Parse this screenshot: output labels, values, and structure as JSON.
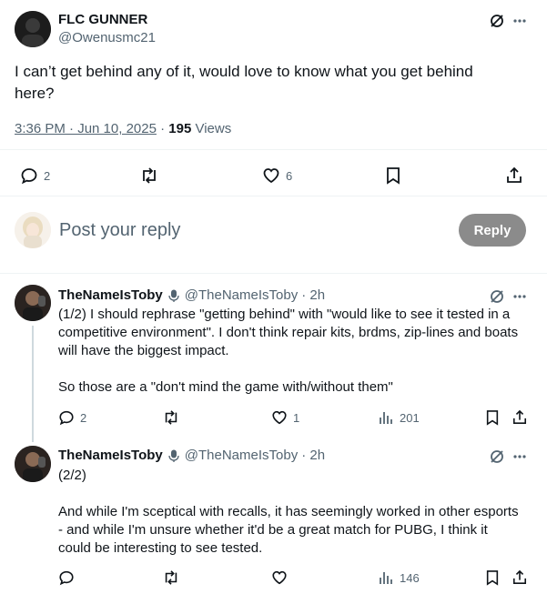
{
  "main_post": {
    "display_name": "FLC GUNNER",
    "handle": "@Owenusmc21",
    "text": "I can’t get behind any of it, would love to know what you get behind here?",
    "time": "3:36 PM · Jun 10, 2025",
    "separator": " · ",
    "views_count": "195",
    "views_label": " Views",
    "actions": {
      "reply_count": "2",
      "repost_count": "",
      "like_count": "6"
    }
  },
  "composer": {
    "placeholder": "Post your reply",
    "reply_button": "Reply"
  },
  "replies": [
    {
      "display_name": "TheNameIsToby",
      "handle": "@TheNameIsToby",
      "time": "· 2h",
      "paragraphs": [
        "(1/2) I should rephrase \"getting behind\" with \"would like to see it tested in a competitive environment\". I don't think repair kits, brdms, zip-lines and boats will have the biggest impact.",
        "So those are a \"don't mind the game with/without them\""
      ],
      "reply_count": "2",
      "repost_count": "",
      "like_count": "1",
      "views_count": "201"
    },
    {
      "display_name": "TheNameIsToby",
      "handle": "@TheNameIsToby",
      "time": "· 2h",
      "paragraphs": [
        "(2/2)",
        "And while I'm sceptical with recalls, it has seemingly worked in other esports - and while I'm unsure whether it'd be a great match for PUBG, I think it could be interesting to see tested."
      ],
      "reply_count": "",
      "repost_count": "",
      "like_count": "",
      "views_count": "146"
    }
  ],
  "colors": {
    "text": "#0f1419",
    "muted": "#536471",
    "divider": "#eff3f4",
    "reply_button_bg": "#8b8b8b"
  },
  "icons": [
    "grok-icon",
    "more-icon",
    "reply-icon",
    "repost-icon",
    "like-icon",
    "bookmark-icon",
    "share-icon",
    "views-icon",
    "microphone-icon"
  ]
}
